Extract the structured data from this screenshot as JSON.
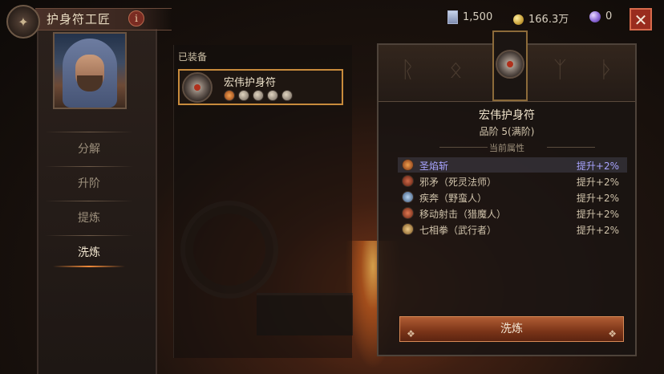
{
  "header": {
    "title": "护身符工匠",
    "info_icon": "i",
    "resources": [
      {
        "icon": "material-icon",
        "value": "1,500"
      },
      {
        "icon": "gold-coin-icon",
        "value": "166.3万"
      },
      {
        "icon": "purple-orb-icon",
        "value": "0"
      }
    ],
    "close": "✕"
  },
  "sidebar": {
    "items": [
      {
        "label": "分解",
        "active": false
      },
      {
        "label": "升阶",
        "active": false
      },
      {
        "label": "提炼",
        "active": false
      },
      {
        "label": "洗炼",
        "active": true
      }
    ]
  },
  "equipped": {
    "section_label": "已装备",
    "item_name": "宏伟护身符",
    "affix_icon_count": 5
  },
  "detail": {
    "name": "宏伟护身符",
    "grade": "品阶 5(满阶)",
    "subtitle": "当前属性",
    "attributes": [
      {
        "name": "圣焰斩",
        "value": "提升+2%",
        "highlight": true,
        "color": "#e2883c"
      },
      {
        "name": "邪矛（死灵法师）",
        "value": "提升+2%",
        "highlight": false,
        "color": "#c45a3a"
      },
      {
        "name": "疾奔（野蛮人）",
        "value": "提升+2%",
        "highlight": false,
        "color": "#8fb3d8"
      },
      {
        "name": "移动射击（猎魔人）",
        "value": "提升+2%",
        "highlight": false,
        "color": "#c8563a"
      },
      {
        "name": "七相拳（武行者）",
        "value": "提升+2%",
        "highlight": false,
        "color": "#e0b070"
      }
    ],
    "button": "洗炼"
  },
  "colors": {
    "accent": "#c88b3c",
    "button": "#9a4a25",
    "highlight_text": "#a8a4ff"
  }
}
